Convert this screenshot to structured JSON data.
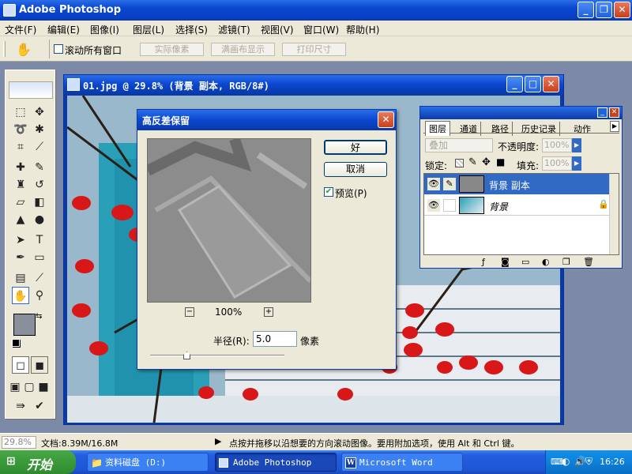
{
  "app": {
    "title": "Adobe Photoshop"
  },
  "menu": [
    "文件(F)",
    "编辑(E)",
    "图像(I)",
    "图层(L)",
    "选择(S)",
    "滤镜(T)",
    "视图(V)",
    "窗口(W)",
    "帮助(H)"
  ],
  "options": {
    "scroll_all_label": "滚动所有窗口",
    "actual_pixels": "实际像素",
    "fit_screen": "满画布显示",
    "print_size": "打印尺寸"
  },
  "document": {
    "title": "01.jpg @ 29.8% (背景 副本, RGB/8#)"
  },
  "dialog": {
    "title": "高反差保留",
    "ok": "好",
    "cancel": "取消",
    "preview_label": "预览(P)",
    "zoom": "100%",
    "radius_label": "半径(R):",
    "radius_value": "5.0",
    "unit": "像素"
  },
  "layers_panel": {
    "tabs": [
      "图层",
      "通道",
      "路径",
      "历史记录",
      "动作"
    ],
    "blend_mode": "叠加",
    "opacity_label": "不透明度:",
    "opacity_value": "100%",
    "lock_label": "锁定:",
    "fill_label": "填充:",
    "fill_value": "100%",
    "layers": [
      {
        "name": "背景 副本",
        "selected": true
      },
      {
        "name": "背景",
        "selected": false
      }
    ]
  },
  "status": {
    "zoom": "29.8%",
    "doc_info": "文档:8.39M/16.8M",
    "hint": "点按并拖移以沿想要的方向滚动图像。要用附加选项，使用 Alt 和 Ctrl 键。"
  },
  "taskbar": {
    "start": "开始",
    "tasks": [
      "资料磁盘 (D:)",
      "Adobe Photoshop",
      "Microsoft Word"
    ],
    "time": "16:26"
  },
  "colors": {
    "accent": "#0a46d0",
    "selection": "#316ac5",
    "lantern": "#d81818"
  }
}
